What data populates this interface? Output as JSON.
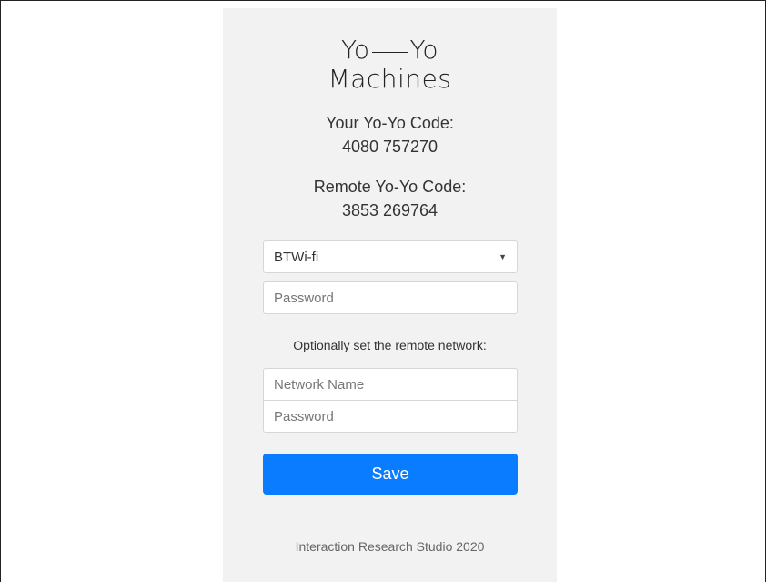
{
  "logo": {
    "left_word": "Yo",
    "right_word": "Yo",
    "second_line": "Machines"
  },
  "your_code": {
    "label": "Your Yo-Yo Code:",
    "value": "4080 757270"
  },
  "remote_code": {
    "label": "Remote Yo-Yo Code:",
    "value": "3853 269764"
  },
  "wifi": {
    "selected_network": "BTWi-fi",
    "caret_icon": "chevron-down-icon",
    "password_placeholder": "Password"
  },
  "remote_network": {
    "prompt": "Optionally set the remote network:",
    "name_placeholder": "Network Name",
    "password_placeholder": "Password"
  },
  "save_label": "Save",
  "footer": "Interaction Research Studio 2020",
  "colors": {
    "accent": "#0a7cff",
    "panel_bg": "#f2f2f2"
  }
}
